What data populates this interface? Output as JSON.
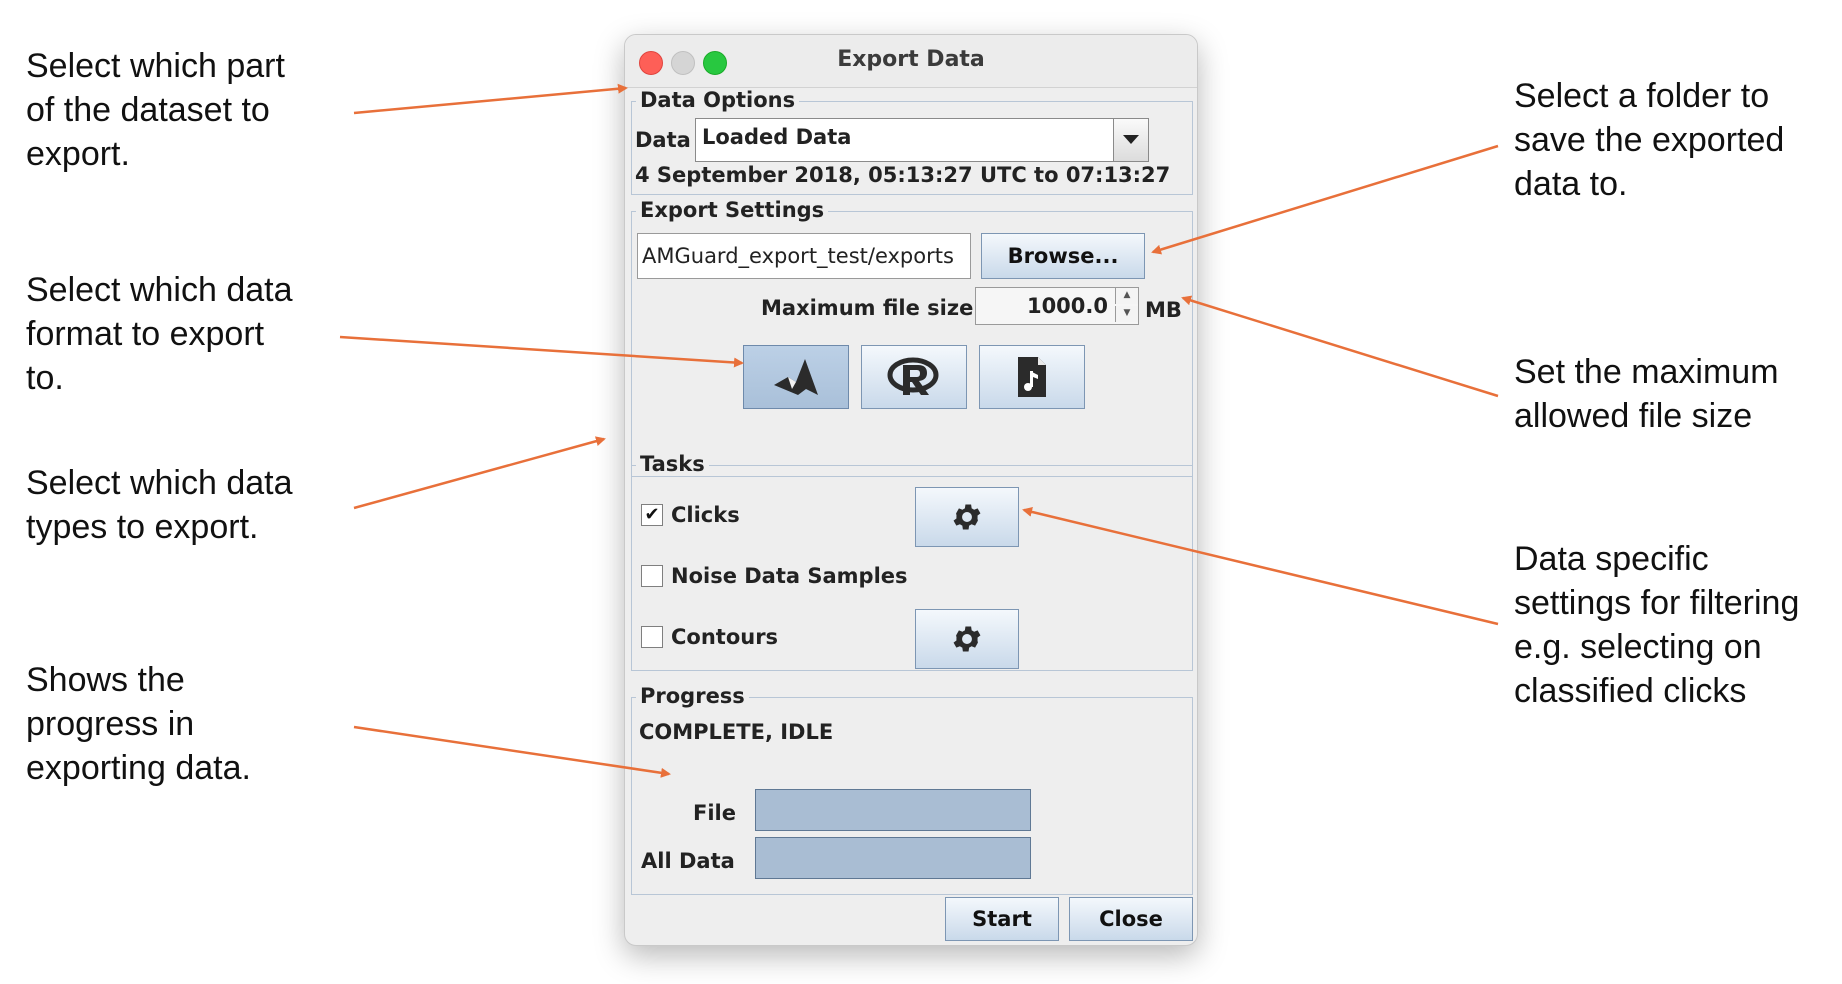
{
  "annotations": {
    "dataset_part": "Select which part\nof the dataset to\nexport.",
    "format": "Select which data\nformat to export\nto.",
    "types": "Select which data\ntypes to export.",
    "progress": "Shows the\nprogress in\nexporting data.",
    "folder": "Select a folder to\nsave the exported\ndata to.",
    "max_size": "Set the maximum\nallowed file size",
    "specific": "Data specific\nsettings for filtering\ne.g. selecting on\nclassified clicks"
  },
  "window": {
    "title": "Export Data",
    "data_options": {
      "legend": "Data Options",
      "data_label": "Data",
      "selected": "Loaded Data",
      "time_range": "4 September 2018, 05:13:27 UTC to 07:13:27"
    },
    "export_settings": {
      "legend": "Export Settings",
      "folder_value": "AMGuard_export_test/exports",
      "browse_label": "Browse...",
      "max_size_label": "Maximum file size",
      "max_size_value": "1000.0",
      "max_size_unit": "MB",
      "formats": [
        "matlab-icon",
        "r-icon",
        "wav-file-icon"
      ],
      "selected_format": "matlab-icon"
    },
    "tasks": {
      "legend": "Tasks",
      "items": [
        {
          "label": "Clicks",
          "checked": true,
          "has_settings": true
        },
        {
          "label": "Noise Data Samples",
          "checked": false,
          "has_settings": false
        },
        {
          "label": "Contours",
          "checked": false,
          "has_settings": true
        }
      ]
    },
    "progress": {
      "legend": "Progress",
      "status": "COMPLETE, IDLE",
      "file_label": "File",
      "all_label": "All Data",
      "file_fraction": 0,
      "all_fraction": 0
    },
    "buttons": {
      "start": "Start",
      "close": "Close"
    }
  },
  "colors": {
    "arrow": "#e8703a",
    "window_bg": "#eeeeee",
    "selected_button": "#bcd0e6"
  }
}
